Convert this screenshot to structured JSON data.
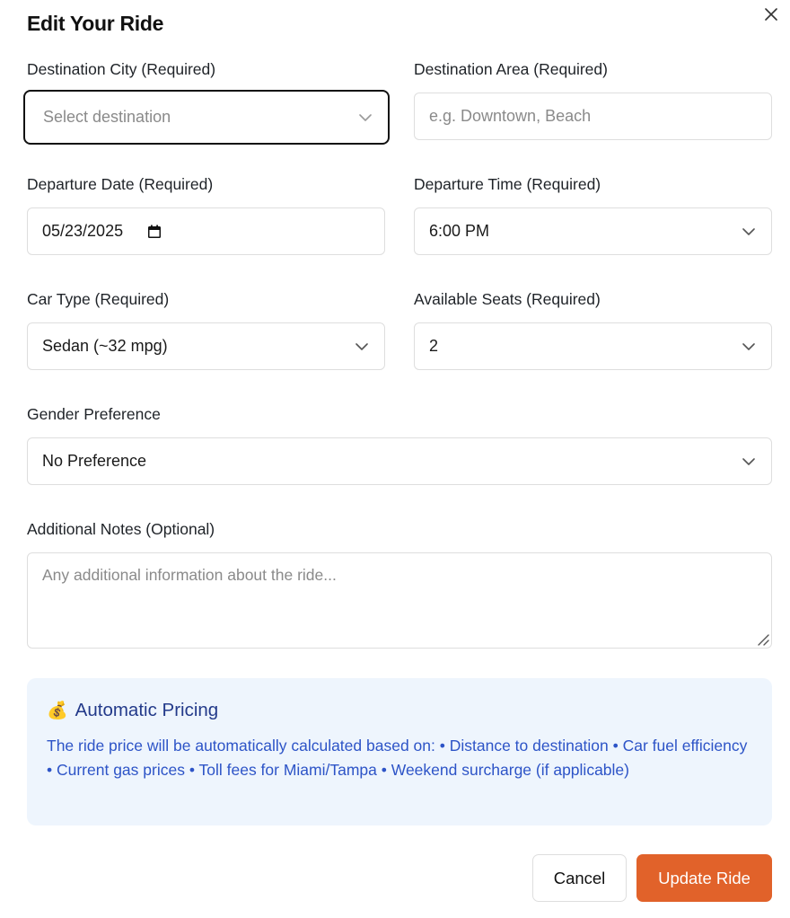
{
  "modal": {
    "title": "Edit Your Ride"
  },
  "fields": {
    "destination_city": {
      "label": "Destination City (Required)",
      "placeholder": "Select destination"
    },
    "destination_area": {
      "label": "Destination Area (Required)",
      "placeholder": "e.g. Downtown, Beach"
    },
    "departure_date": {
      "label": "Departure Date (Required)",
      "value": "05/23/2025"
    },
    "departure_time": {
      "label": "Departure Time (Required)",
      "value": "6:00 PM"
    },
    "car_type": {
      "label": "Car Type (Required)",
      "value": "Sedan (~32 mpg)"
    },
    "available_seats": {
      "label": "Available Seats (Required)",
      "value": "2"
    },
    "gender_preference": {
      "label": "Gender Preference",
      "value": "No Preference"
    },
    "notes": {
      "label": "Additional Notes (Optional)",
      "placeholder": "Any additional information about the ride..."
    }
  },
  "pricing": {
    "icon": "money-bag",
    "title": "Automatic Pricing",
    "description": "The ride price will be automatically calculated based on: • Distance to destination • Car fuel efficiency • Current gas prices • Toll fees for Miami/Tampa • Weekend surcharge (if applicable)"
  },
  "buttons": {
    "cancel": "Cancel",
    "update": "Update Ride"
  },
  "colors": {
    "accent": "#e1622a",
    "info_bg": "#eef5fd",
    "info_title": "#233a8a",
    "info_text": "#2d54c7"
  }
}
